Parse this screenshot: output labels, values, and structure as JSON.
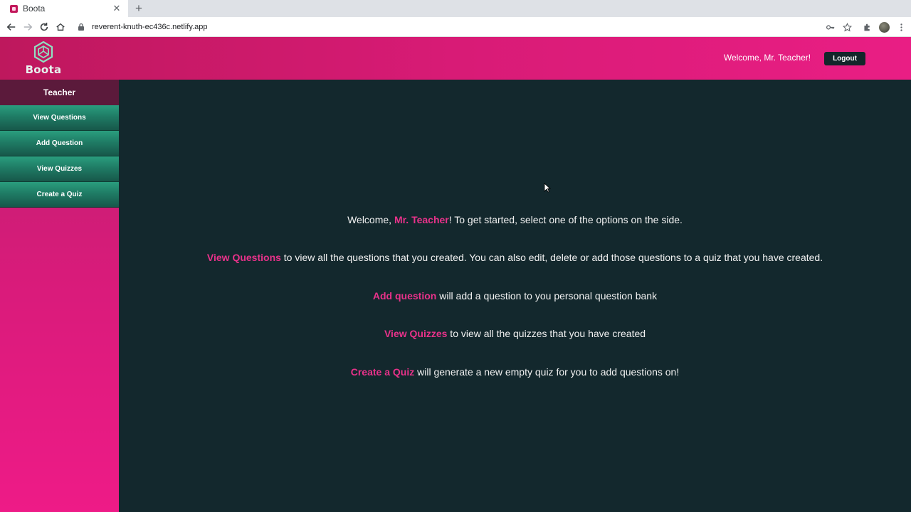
{
  "browser": {
    "tab_title": "Boota",
    "url": "reverent-knuth-ec436c.netlify.app"
  },
  "header": {
    "brand_name": "Boota",
    "welcome_text": "Welcome, Mr. Teacher!",
    "logout_label": "Logout"
  },
  "sidebar": {
    "title": "Teacher",
    "items": [
      {
        "label": "View Questions"
      },
      {
        "label": "Add Question"
      },
      {
        "label": "View Quizzes"
      },
      {
        "label": "Create a Quiz"
      }
    ]
  },
  "main": {
    "intro": {
      "before": "Welcome, ",
      "name": "Mr. Teacher",
      "after": "! To get started, select one of the options on the side."
    },
    "lines": [
      {
        "link": "View Questions",
        "text": " to view all the questions that you created. You can also edit, delete or add those questions to a quiz that you have created."
      },
      {
        "link": "Add question",
        "text": " will add a question to you personal question bank"
      },
      {
        "link": "View Quizzes",
        "text": " to view all the quizzes that you have created"
      },
      {
        "link": "Create a Quiz",
        "text": " will generate a new empty quiz for you to add questions on!"
      }
    ]
  },
  "colors": {
    "header_pink": "#d81b76",
    "main_bg": "#13282d",
    "sidebar_item_green": "#1f7c65",
    "highlight": "#e8328a"
  }
}
